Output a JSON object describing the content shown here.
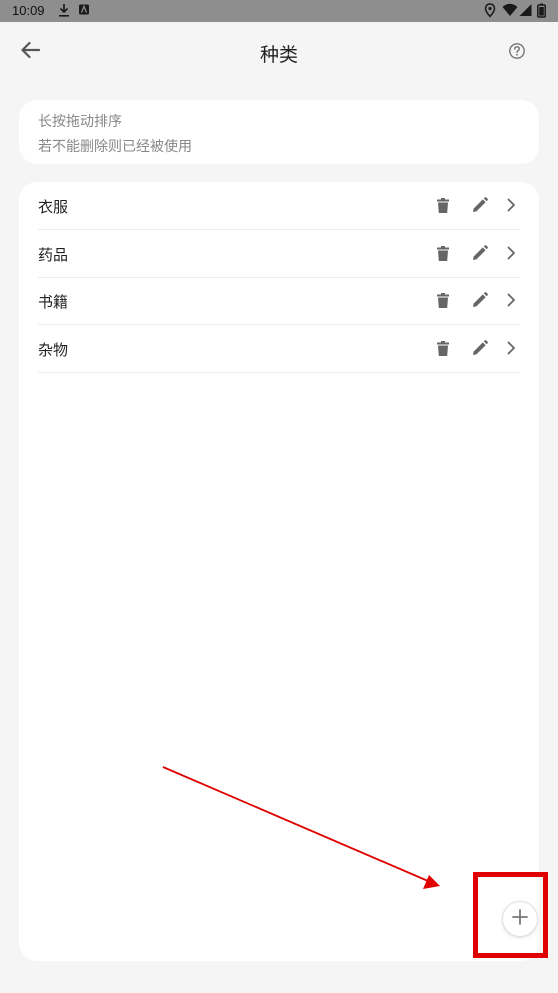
{
  "status_bar": {
    "time": "10:09"
  },
  "app_bar": {
    "title": "种类",
    "back_icon": "arrow-left-icon",
    "help_icon": "help-circle-icon"
  },
  "hint": {
    "line1": "长按拖动排序",
    "line2": "若不能删除则已经被使用"
  },
  "categories": [
    {
      "label": "衣服"
    },
    {
      "label": "药品"
    },
    {
      "label": "书籍"
    },
    {
      "label": "杂物"
    }
  ],
  "row_icons": {
    "delete": "trash-icon",
    "edit": "pencil-icon",
    "open": "chevron-right-icon"
  },
  "fab": {
    "icon": "plus-icon"
  },
  "annotation": {
    "color": "#e00000"
  }
}
